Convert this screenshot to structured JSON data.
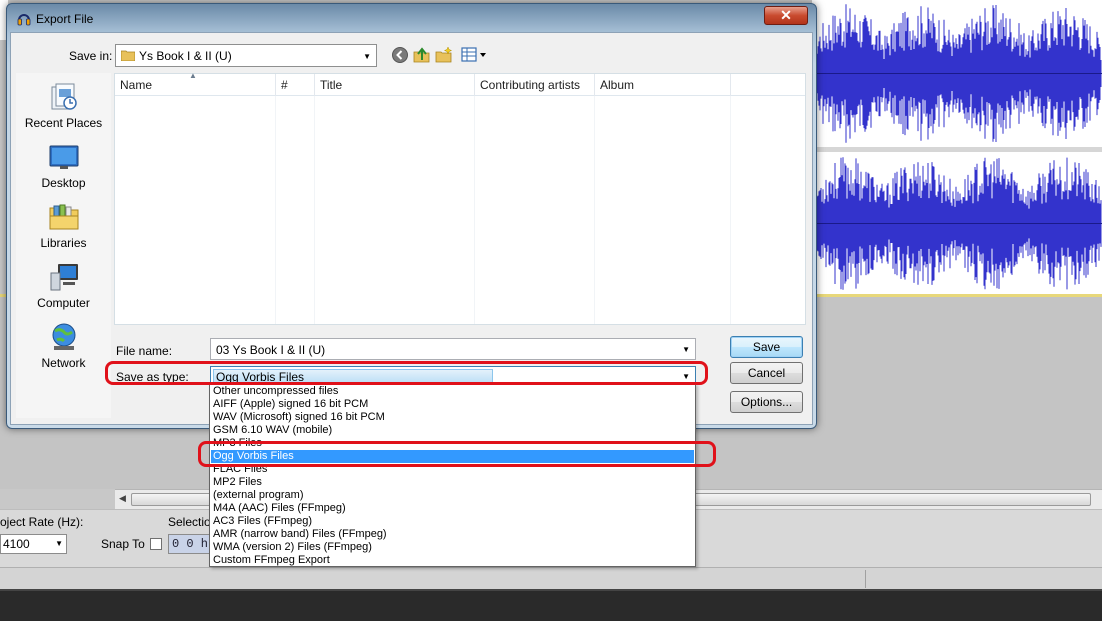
{
  "dialog": {
    "title": "Export File",
    "close_label": "✕",
    "save_in_label": "Save in:",
    "save_in_value": "Ys Book I & II (U)",
    "places": [
      {
        "label": "Recent Places",
        "icon": "recent-places-icon"
      },
      {
        "label": "Desktop",
        "icon": "desktop-icon"
      },
      {
        "label": "Libraries",
        "icon": "libraries-icon"
      },
      {
        "label": "Computer",
        "icon": "computer-icon"
      },
      {
        "label": "Network",
        "icon": "network-icon"
      }
    ],
    "columns": [
      "Name",
      "#",
      "Title",
      "Contributing artists",
      "Album"
    ],
    "file_name_label": "File name:",
    "file_name_value": "03 Ys Book I & II (U)",
    "save_type_label": "Save as type:",
    "save_type_value": "Ogg Vorbis Files",
    "buttons": {
      "save": "Save",
      "cancel": "Cancel",
      "options": "Options..."
    }
  },
  "type_options": [
    "Other uncompressed files",
    "AIFF (Apple) signed 16 bit PCM",
    "WAV (Microsoft) signed 16 bit PCM",
    "GSM 6.10 WAV (mobile)",
    "MP3 Files",
    "Ogg Vorbis Files",
    "FLAC Files",
    "MP2 Files",
    "(external program)",
    "M4A (AAC) Files (FFmpeg)",
    "AC3 Files (FFmpeg)",
    "AMR (narrow band) Files (FFmpeg)",
    "WMA (version 2) Files (FFmpeg)",
    "Custom FFmpeg Export"
  ],
  "highlighted_option": "Ogg Vorbis Files",
  "background_app": {
    "project_rate_label": "oject Rate (Hz):",
    "project_rate_value": "4100",
    "snap_to_label": "Snap To",
    "selection_label": "Selectio",
    "time_value": "0 0 h"
  },
  "colors": {
    "waveform": "#3333cc",
    "highlight": "#3399ff",
    "annotation": "#e0111a"
  }
}
